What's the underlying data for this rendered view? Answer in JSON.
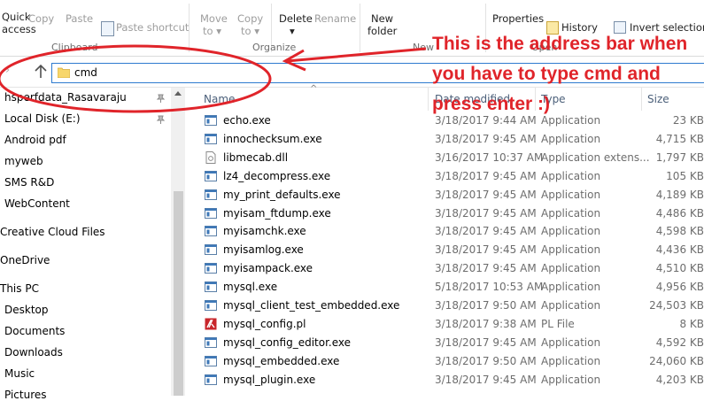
{
  "ribbon": {
    "clipboard": {
      "quick_label": "Quick",
      "access_label": "access",
      "copy_label": "Copy",
      "paste_label": "Paste",
      "paste_shortcut_label": "Paste shortcut",
      "group_label": "Clipboard"
    },
    "organize": {
      "move_label": "Move",
      "move_to_label": "to",
      "copy_label": "Copy",
      "copy_to_label": "to",
      "delete_label": "Delete",
      "rename_label": "Rename",
      "group_label": "Organize"
    },
    "new": {
      "new_label": "New",
      "folder_label": "folder",
      "group_label": "New"
    },
    "open": {
      "properties_label": "Properties",
      "history_label": "History",
      "group_label": "Open"
    },
    "select": {
      "invert_selection_label": "Invert selection"
    }
  },
  "address_bar": {
    "value": "cmd"
  },
  "navigation_pane": {
    "items": [
      {
        "label": "hsperfdata_Rasavaraju",
        "pinned": true
      },
      {
        "label": "Local Disk (E:)",
        "pinned": true
      },
      {
        "label": "Android pdf"
      },
      {
        "label": "myweb"
      },
      {
        "label": "SMS R&D"
      },
      {
        "label": "WebContent"
      },
      {
        "label": "Creative Cloud Files"
      },
      {
        "label": "OneDrive"
      },
      {
        "label": "This PC"
      },
      {
        "label": "Desktop"
      },
      {
        "label": "Documents"
      },
      {
        "label": "Downloads"
      },
      {
        "label": "Music"
      },
      {
        "label": "Pictures"
      }
    ]
  },
  "file_list": {
    "columns": {
      "name": "Name",
      "date_modified": "Date modified",
      "type": "Type",
      "size": "Size"
    },
    "files": [
      {
        "name": "echo.exe",
        "date": "3/18/2017 9:44 AM",
        "type": "Application",
        "size": "23 KB",
        "icon": "application-icon"
      },
      {
        "name": "innochecksum.exe",
        "date": "3/18/2017 9:45 AM",
        "type": "Application",
        "size": "4,715 KB",
        "icon": "application-icon"
      },
      {
        "name": "libmecab.dll",
        "date": "3/16/2017 10:37 AM",
        "type": "Application extens...",
        "size": "1,797 KB",
        "icon": "dll-icon"
      },
      {
        "name": "lz4_decompress.exe",
        "date": "3/18/2017 9:45 AM",
        "type": "Application",
        "size": "105 KB",
        "icon": "application-icon"
      },
      {
        "name": "my_print_defaults.exe",
        "date": "3/18/2017 9:45 AM",
        "type": "Application",
        "size": "4,189 KB",
        "icon": "application-icon"
      },
      {
        "name": "myisam_ftdump.exe",
        "date": "3/18/2017 9:45 AM",
        "type": "Application",
        "size": "4,486 KB",
        "icon": "application-icon"
      },
      {
        "name": "myisamchk.exe",
        "date": "3/18/2017 9:45 AM",
        "type": "Application",
        "size": "4,598 KB",
        "icon": "application-icon"
      },
      {
        "name": "myisamlog.exe",
        "date": "3/18/2017 9:45 AM",
        "type": "Application",
        "size": "4,436 KB",
        "icon": "application-icon"
      },
      {
        "name": "myisampack.exe",
        "date": "3/18/2017 9:45 AM",
        "type": "Application",
        "size": "4,510 KB",
        "icon": "application-icon"
      },
      {
        "name": "mysql.exe",
        "date": "5/18/2017 10:53 AM",
        "type": "Application",
        "size": "4,956 KB",
        "icon": "application-icon"
      },
      {
        "name": "mysql_client_test_embedded.exe",
        "date": "3/18/2017 9:50 AM",
        "type": "Application",
        "size": "24,503 KB",
        "icon": "application-icon"
      },
      {
        "name": "mysql_config.pl",
        "date": "3/18/2017 9:38 AM",
        "type": "PL File",
        "size": "8 KB",
        "icon": "perl-file-icon"
      },
      {
        "name": "mysql_config_editor.exe",
        "date": "3/18/2017 9:45 AM",
        "type": "Application",
        "size": "4,592 KB",
        "icon": "application-icon"
      },
      {
        "name": "mysql_embedded.exe",
        "date": "3/18/2017 9:50 AM",
        "type": "Application",
        "size": "24,060 KB",
        "icon": "application-icon"
      },
      {
        "name": "mysql_plugin.exe",
        "date": "3/18/2017 9:45 AM",
        "type": "Application",
        "size": "4,203 KB",
        "icon": "application-icon"
      }
    ]
  },
  "annotation": {
    "lines": [
      "This is the address bar when",
      "you have to type cmd and",
      "press enter :)"
    ],
    "color": "#e0242a"
  },
  "colors": {
    "address_border": "#2e7bcf",
    "folder_yellow": "#f7d66b",
    "header_text": "#4c607a"
  }
}
